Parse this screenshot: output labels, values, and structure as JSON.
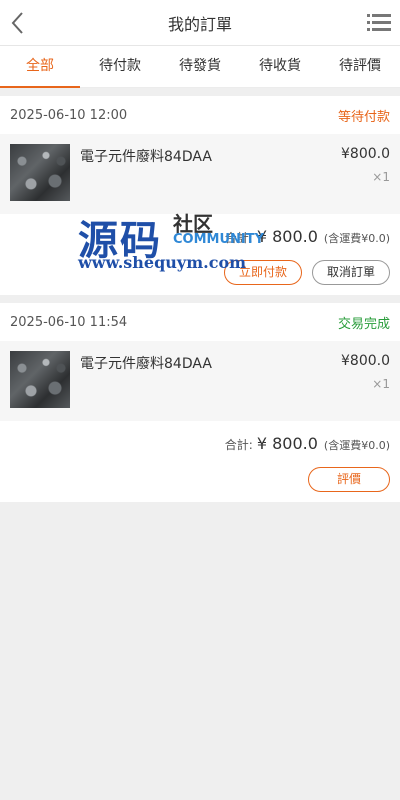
{
  "header": {
    "title": "我的訂單",
    "back_icon": "chevron-left-icon",
    "menu_icon": "list-menu-icon"
  },
  "tabs": [
    {
      "label": "全部",
      "active": true
    },
    {
      "label": "待付款",
      "active": false
    },
    {
      "label": "待發貨",
      "active": false
    },
    {
      "label": "待收貨",
      "active": false
    },
    {
      "label": "待評價",
      "active": false
    }
  ],
  "orders": [
    {
      "time": "2025-06-10 12:00",
      "status": "等待付款",
      "status_color": "#e8661b",
      "item": {
        "name": "電子元件廢料84DAA",
        "price": "¥800.0",
        "qty": "×1"
      },
      "total_label": "合計:",
      "total_amount": "¥ 800.0",
      "shipping": "(含運費¥0.0)",
      "actions": [
        "立即付款",
        "取消訂單"
      ]
    },
    {
      "time": "2025-06-10 11:54",
      "status": "交易完成",
      "status_color": "#2a9d3b",
      "item": {
        "name": "電子元件廢料84DAA",
        "price": "¥800.0",
        "qty": "×1"
      },
      "total_label": "合計:",
      "total_amount": "¥ 800.0",
      "shipping": "(含運費¥0.0)",
      "actions": [
        "評價"
      ]
    }
  ],
  "watermark": {
    "big": "源码",
    "small_cn": "社区",
    "small_en": "COMMUNITY",
    "url": "www.shequym.com"
  },
  "colors": {
    "accent": "#e8661b",
    "success": "#2a9d3b",
    "background": "#efefef"
  }
}
